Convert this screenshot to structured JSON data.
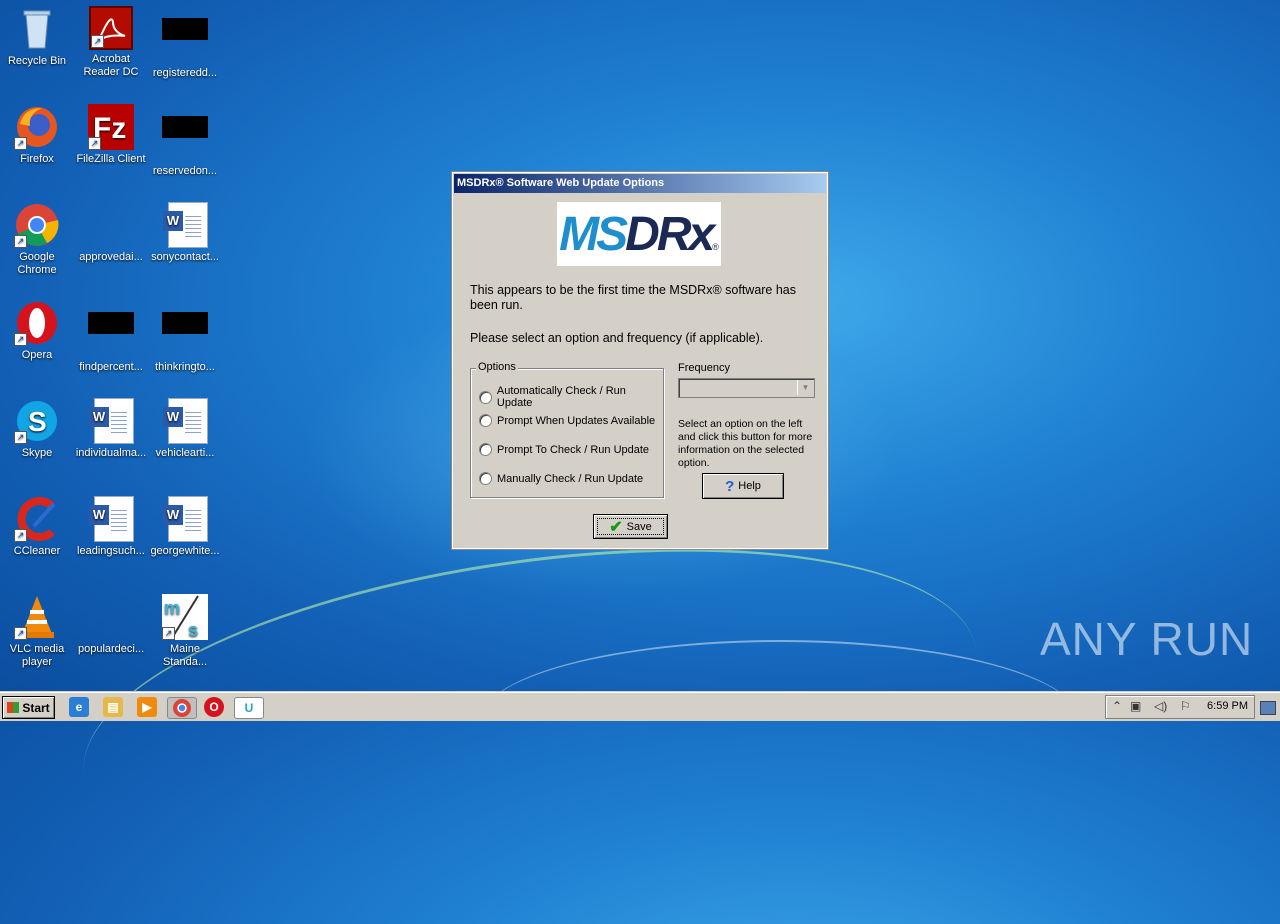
{
  "desktop": {
    "icons": [
      {
        "label": "Recycle Bin"
      },
      {
        "label": "Acrobat Reader DC"
      },
      {
        "label": "registeredd..."
      },
      {
        "label": "Firefox"
      },
      {
        "label": "FileZilla Client"
      },
      {
        "label": "reservedon..."
      },
      {
        "label": "Google Chrome"
      },
      {
        "label": "approvedai..."
      },
      {
        "label": "sonycontact..."
      },
      {
        "label": "Opera"
      },
      {
        "label": "findpercent..."
      },
      {
        "label": "thinkringto..."
      },
      {
        "label": "Skype"
      },
      {
        "label": "individualma..."
      },
      {
        "label": "vehiclearti..."
      },
      {
        "label": "CCleaner"
      },
      {
        "label": "leadingsuch..."
      },
      {
        "label": "georgewhite..."
      },
      {
        "label": "VLC media player"
      },
      {
        "label": "populardeci..."
      },
      {
        "label": "Maine Standa..."
      }
    ]
  },
  "dialog": {
    "title": "MSDRx® Software Web Update Options",
    "logo_ms": "MS",
    "logo_drx": "DRx",
    "logo_reg": "®",
    "message1": "This appears to be the first time the MSDRx® software has been run.",
    "message2": "Please select an option and frequency (if applicable).",
    "options_label": "Options",
    "options": [
      "Automatically Check / Run Update",
      "Prompt When Updates Available",
      "Prompt To Check / Run Update",
      "Manually Check / Run Update"
    ],
    "frequency_label": "Frequency",
    "frequency_value": "",
    "help_text": "Select an option on the left and click this button for more  information on the selected option.",
    "help_button": "Help",
    "save_button": "Save"
  },
  "watermark": "ANY RUN",
  "taskbar": {
    "start_label": "Start",
    "clock": "6:59 PM"
  }
}
